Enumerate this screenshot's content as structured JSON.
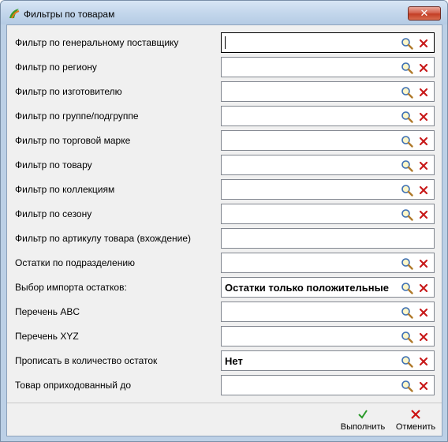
{
  "window": {
    "title": "Фильтры по товарам"
  },
  "filters": [
    {
      "label": "Фильтр по генеральному поставщику",
      "value": "",
      "focused": true,
      "buttons": true
    },
    {
      "label": "Фильтр по региону",
      "value": "",
      "buttons": true
    },
    {
      "label": "Фильтр по изготовителю",
      "value": "",
      "buttons": true
    },
    {
      "label": "Фильтр по группе/подгруппе",
      "value": "",
      "buttons": true
    },
    {
      "label": "Фильтр по торговой марке",
      "value": "",
      "buttons": true
    },
    {
      "label": "Фильтр по товару",
      "value": "",
      "buttons": true
    },
    {
      "label": "Фильтр по коллекциям",
      "value": "",
      "buttons": true
    },
    {
      "label": "Фильтр по сезону",
      "value": "",
      "buttons": true
    },
    {
      "label": "Фильтр по артикулу товара (вхождение)",
      "value": "",
      "buttons": false
    },
    {
      "label": "Остатки по подразделению",
      "value": "",
      "buttons": true
    },
    {
      "label": "Выбор импорта остатков:",
      "value": "Остатки только положительные",
      "buttons": true
    },
    {
      "label": "Перечень ABC",
      "value": "",
      "buttons": true
    },
    {
      "label": "Перечень XYZ",
      "value": "",
      "buttons": true
    },
    {
      "label": "Прописать в количество остаток",
      "value": "Нет",
      "buttons": true
    },
    {
      "label": "Товар оприходованный до",
      "value": "",
      "buttons": true
    }
  ],
  "footer": {
    "execute_label": "Выполнить",
    "cancel_label": "Отменить"
  },
  "colors": {
    "execute_icon": "#2a9a2a",
    "cancel_icon": "#cc1111",
    "clear_icon": "#c81a1a"
  },
  "icons": {
    "search": "magnifier-icon",
    "clear": "clear-x-icon",
    "execute": "checkmark-icon",
    "cancel": "cancel-x-icon"
  }
}
